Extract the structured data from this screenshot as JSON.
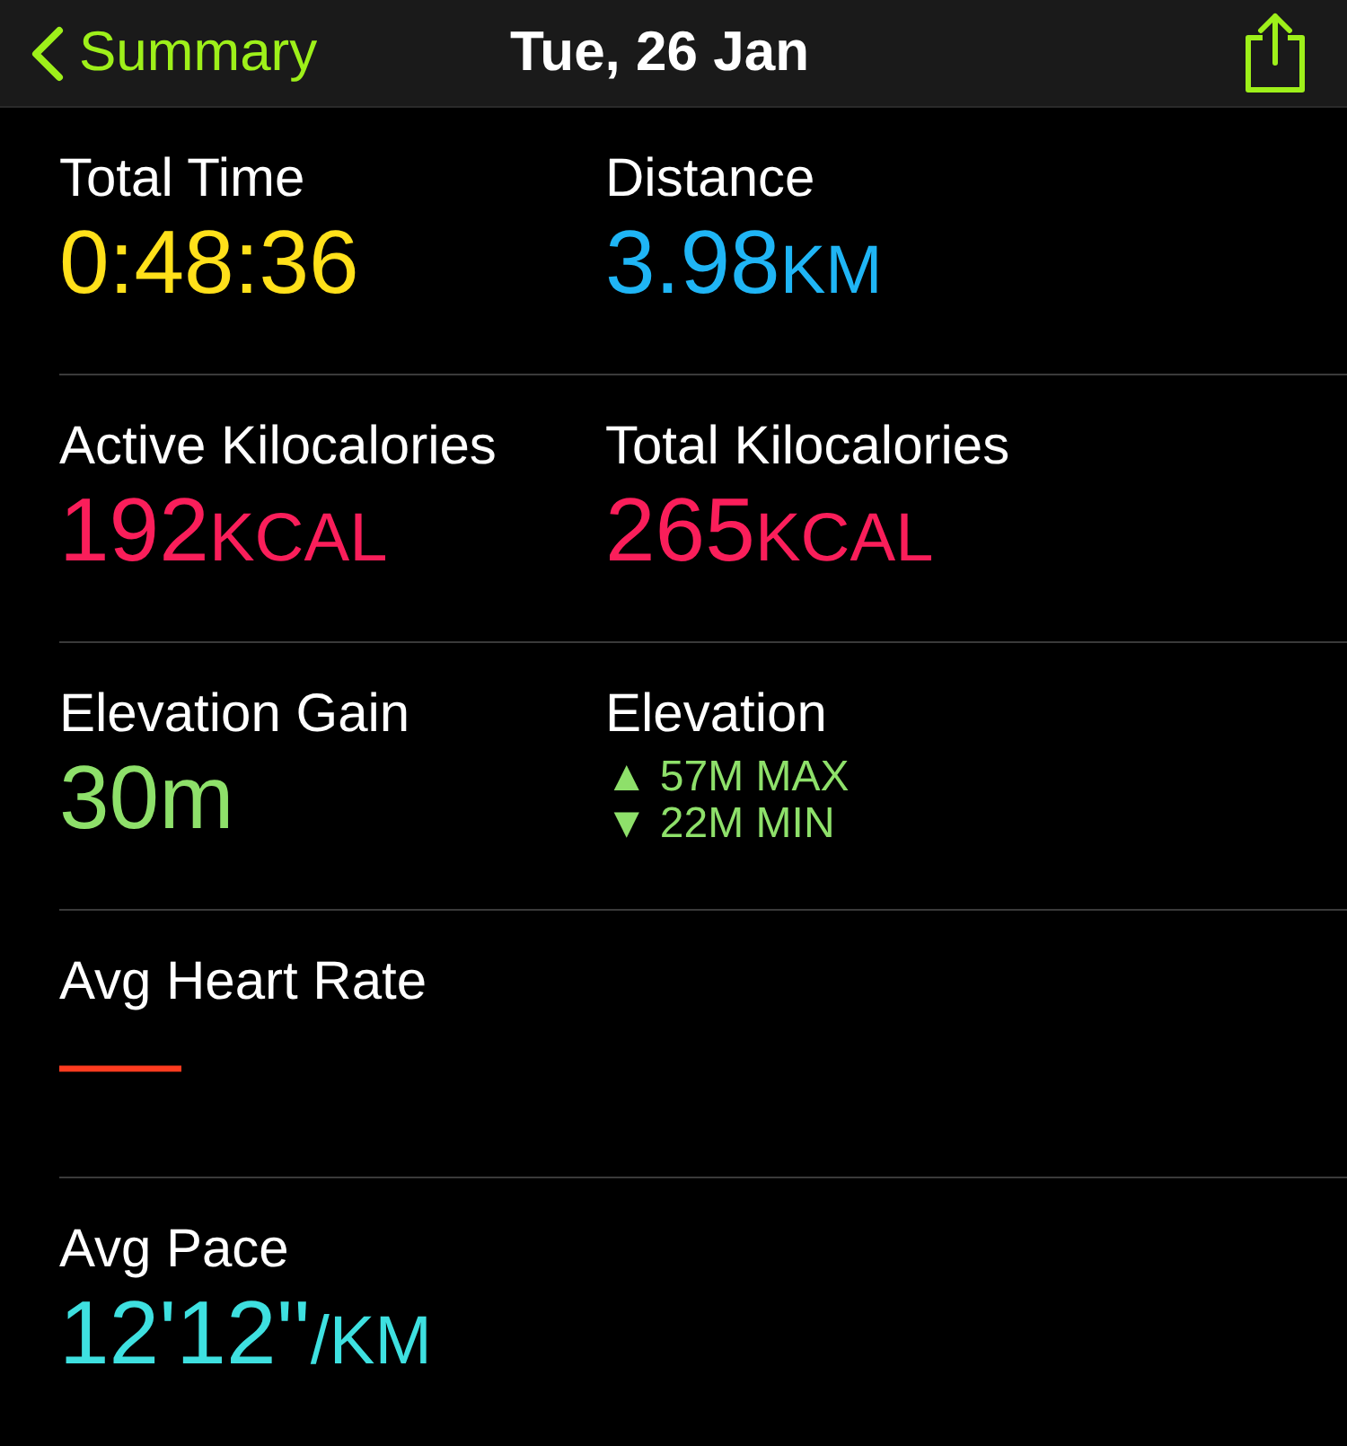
{
  "nav": {
    "back": "Summary",
    "title": "Tue, 26 Jan"
  },
  "rows": [
    {
      "metrics": [
        {
          "label": "Total Time",
          "kind": "value",
          "value": "0:48:36",
          "color": "#ffe01a"
        },
        {
          "label": "Distance",
          "kind": "value",
          "value": "3.98",
          "unit": "KM",
          "color": "#1fb5f5"
        }
      ]
    },
    {
      "metrics": [
        {
          "label": "Active Kilocalories",
          "kind": "value",
          "value": "192",
          "unit": "KCAL",
          "color": "#fa1e5a"
        },
        {
          "label": "Total Kilocalories",
          "kind": "value",
          "value": "265",
          "unit": "KCAL",
          "color": "#fa1e5a"
        }
      ]
    },
    {
      "metrics": [
        {
          "label": "Elevation Gain",
          "kind": "value",
          "value": "30m",
          "color": "#8ee06a"
        },
        {
          "label": "Elevation",
          "kind": "range",
          "lines": [
            "▲ 57M MAX",
            "▼ 22M MIN"
          ],
          "color": "#8ee06a"
        }
      ]
    },
    {
      "metrics": [
        {
          "label": "Avg Heart Rate",
          "kind": "empty",
          "value": "——",
          "color": "#ff3b1f"
        }
      ]
    },
    {
      "metrics": [
        {
          "label": "Avg Pace",
          "kind": "value",
          "value": "12'12''",
          "unit": "/KM",
          "color": "#3ee0e0"
        }
      ]
    }
  ]
}
